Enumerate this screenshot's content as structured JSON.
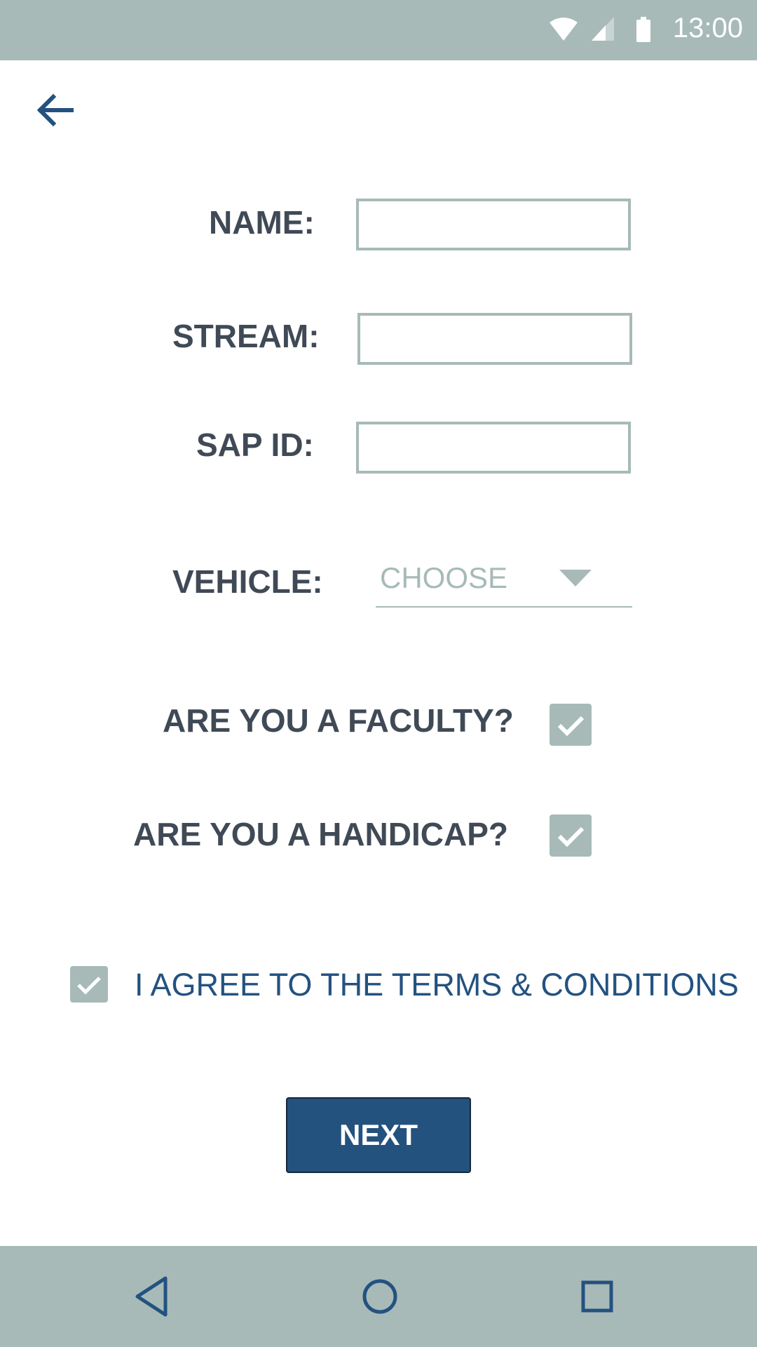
{
  "status_bar": {
    "time": "13:00",
    "icons": [
      "wifi-icon",
      "cell-signal-icon",
      "battery-icon"
    ]
  },
  "header": {
    "back_icon": "arrow-left-icon"
  },
  "form": {
    "name_label": "NAME:",
    "name_value": "",
    "stream_label": "STREAM:",
    "stream_value": "",
    "sapid_label": "SAP ID:",
    "sapid_value": "",
    "vehicle_label": "VEHICLE:",
    "vehicle_selected": "CHOOSE",
    "faculty_label": "ARE YOU A FACULTY?",
    "faculty_checked": true,
    "handicap_label": "ARE YOU A HANDICAP?",
    "handicap_checked": true,
    "terms_label": "I AGREE TO THE TERMS & CONDITIONS",
    "terms_checked": true,
    "next_label": "NEXT"
  },
  "nav_bar": {
    "icons": [
      "back-triangle-icon",
      "home-circle-icon",
      "recents-square-icon"
    ]
  },
  "colors": {
    "accent": "#24527e",
    "bars": "#a7bab8",
    "label_text": "#404a56",
    "terms_text": "#235280"
  }
}
